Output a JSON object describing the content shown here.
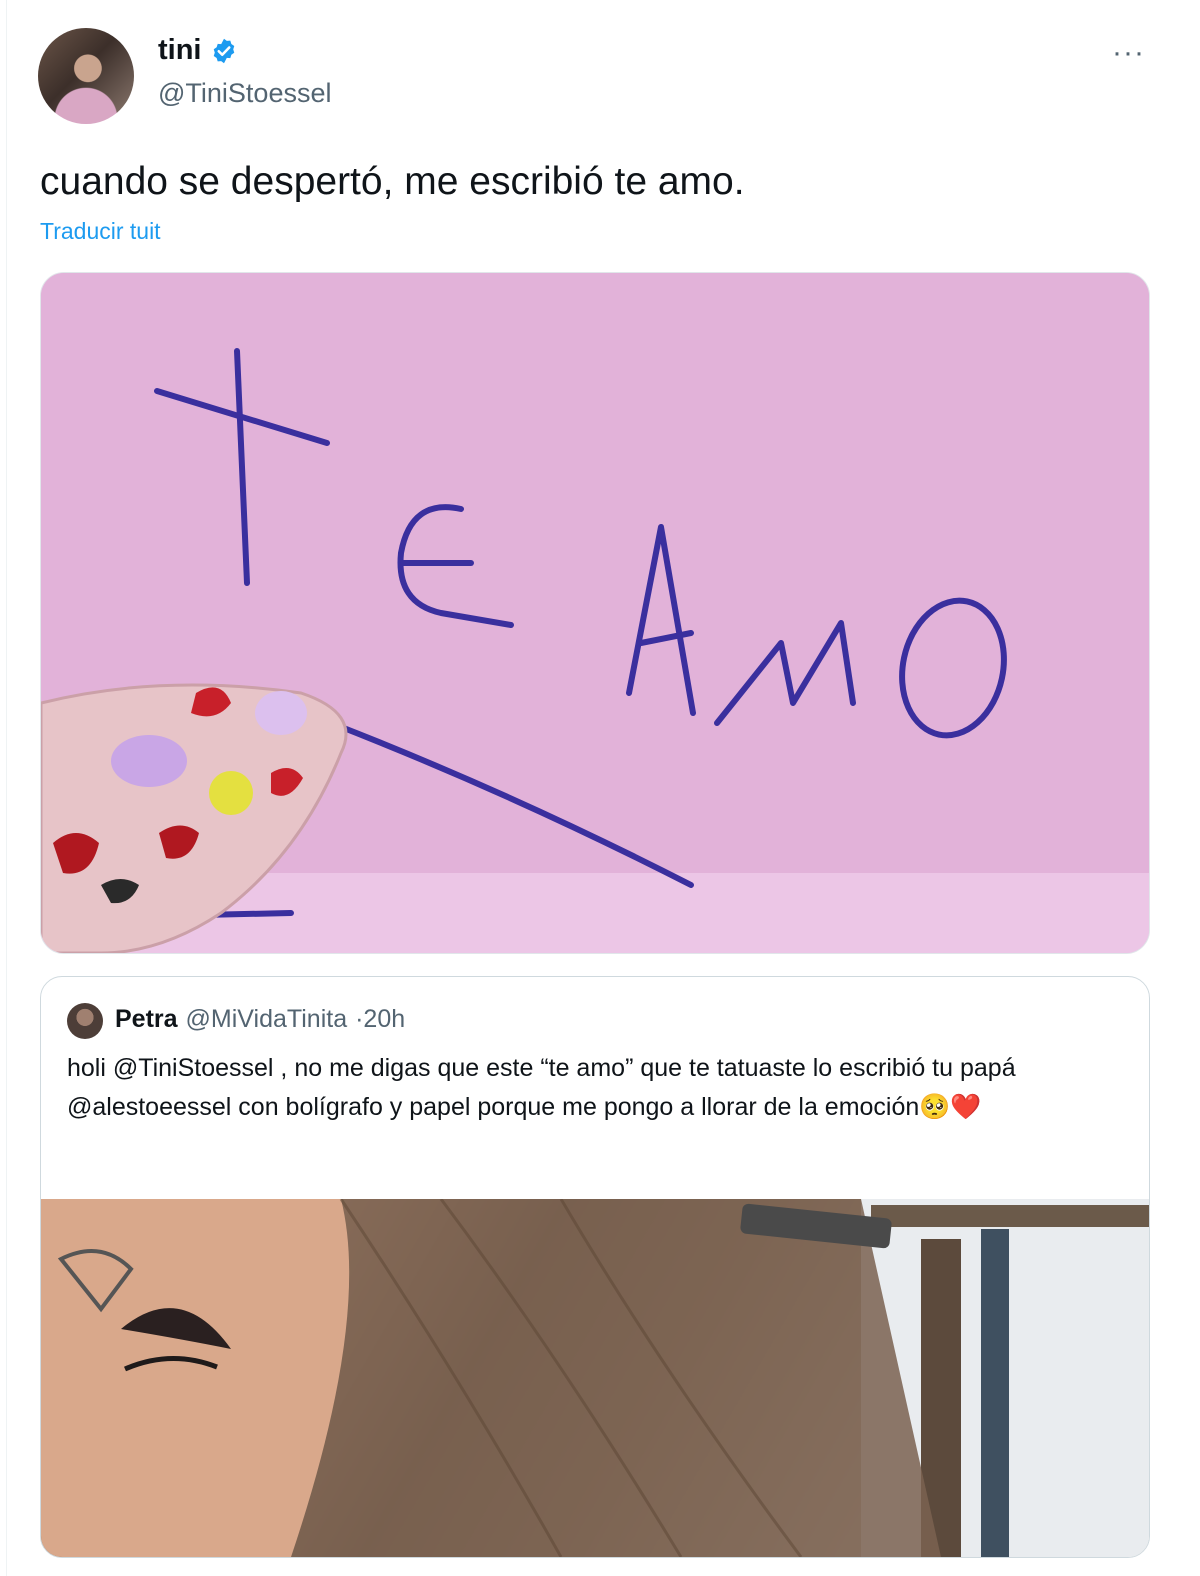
{
  "author": {
    "name": "tini",
    "handle": "@TiniStoessel",
    "verified_icon": "verified-badge-icon"
  },
  "menu": {
    "more_label": "···"
  },
  "tweet": {
    "text": "cuando se despertó, me escribió te amo.",
    "translate_label": "Traducir tuit"
  },
  "quoted": {
    "name": "Petra",
    "handle": "@MiVidaTinita",
    "time": "·20h",
    "text": "holi @TiniStoessel , no me digas que este “te amo” que te tatuaste lo escribió tu papá @alestoeessel con bolígrafo y papel porque me pongo a llorar de la emoción🥺❤️"
  },
  "colors": {
    "accent": "#1d9bf0",
    "secondary_text": "#536471",
    "text": "#0f1419"
  }
}
